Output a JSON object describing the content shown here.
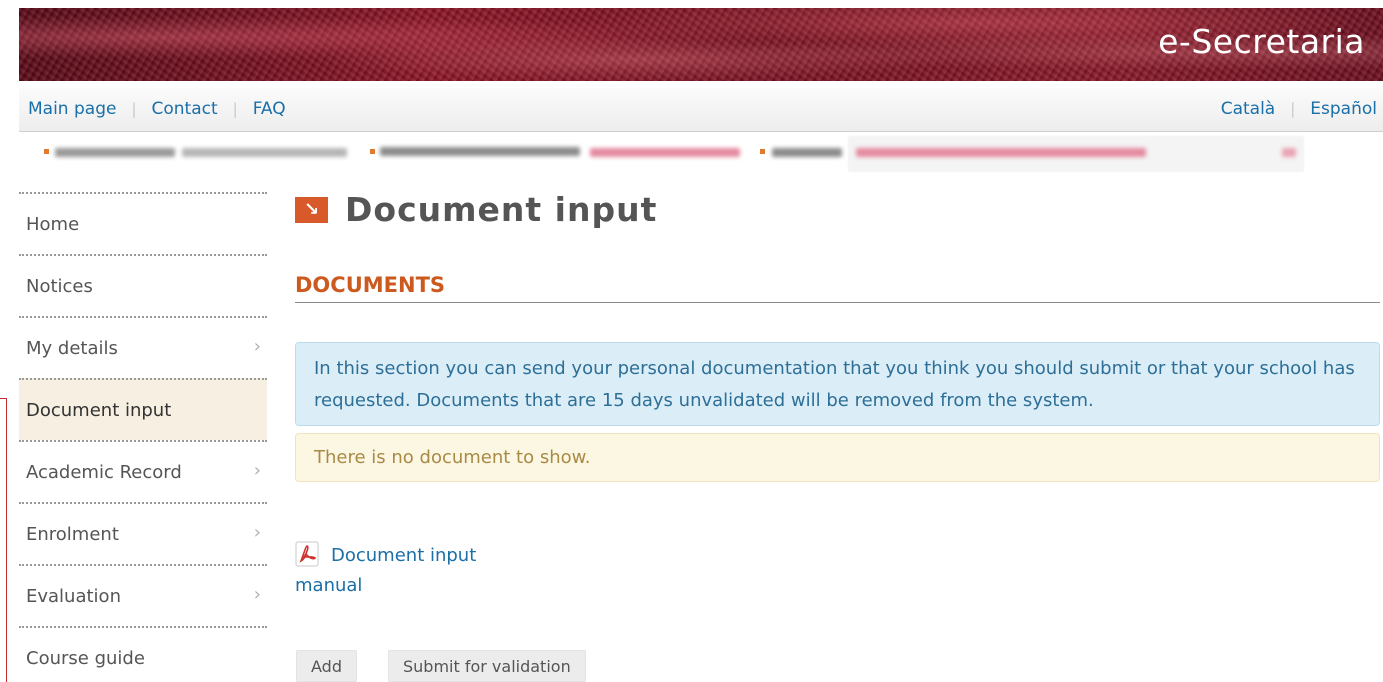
{
  "banner": {
    "title": "e-Secretaria"
  },
  "topnav": {
    "left_links": [
      "Main page",
      "Contact",
      "FAQ"
    ],
    "right_links": [
      "Català",
      "Español"
    ],
    "separator": "|"
  },
  "sidebar": {
    "items": [
      {
        "label": "Home",
        "has_chevron": false,
        "active": false
      },
      {
        "label": "Notices",
        "has_chevron": false,
        "active": false
      },
      {
        "label": "My details",
        "has_chevron": true,
        "active": false
      },
      {
        "label": "Document input",
        "has_chevron": false,
        "active": true
      },
      {
        "label": "Academic Record",
        "has_chevron": true,
        "active": false
      },
      {
        "label": "Enrolment",
        "has_chevron": true,
        "active": false
      },
      {
        "label": "Evaluation",
        "has_chevron": true,
        "active": false
      },
      {
        "label": "Course guide",
        "has_chevron": false,
        "active": false
      }
    ],
    "chevron": "›"
  },
  "main": {
    "title_icon": "arrow-down-right-icon",
    "title_icon_glyph": "↘",
    "title": "Document input",
    "section_title": "DOCUMENTS",
    "info_text": "In this section you can send your personal documentation that you think you should submit or that your school has requested. Documents that are 15 days unvalidated will be removed from the system.",
    "warning_text": "There is no document to show.",
    "manual_link": "Document input manual",
    "buttons": {
      "add": "Add",
      "submit": "Submit for validation"
    }
  },
  "colors": {
    "accent": "#cc5a1f",
    "link": "#1a6fa8",
    "info_bg": "#dbeef8",
    "warn_bg": "#fcf7e3",
    "active_bg": "#f6efe2"
  }
}
